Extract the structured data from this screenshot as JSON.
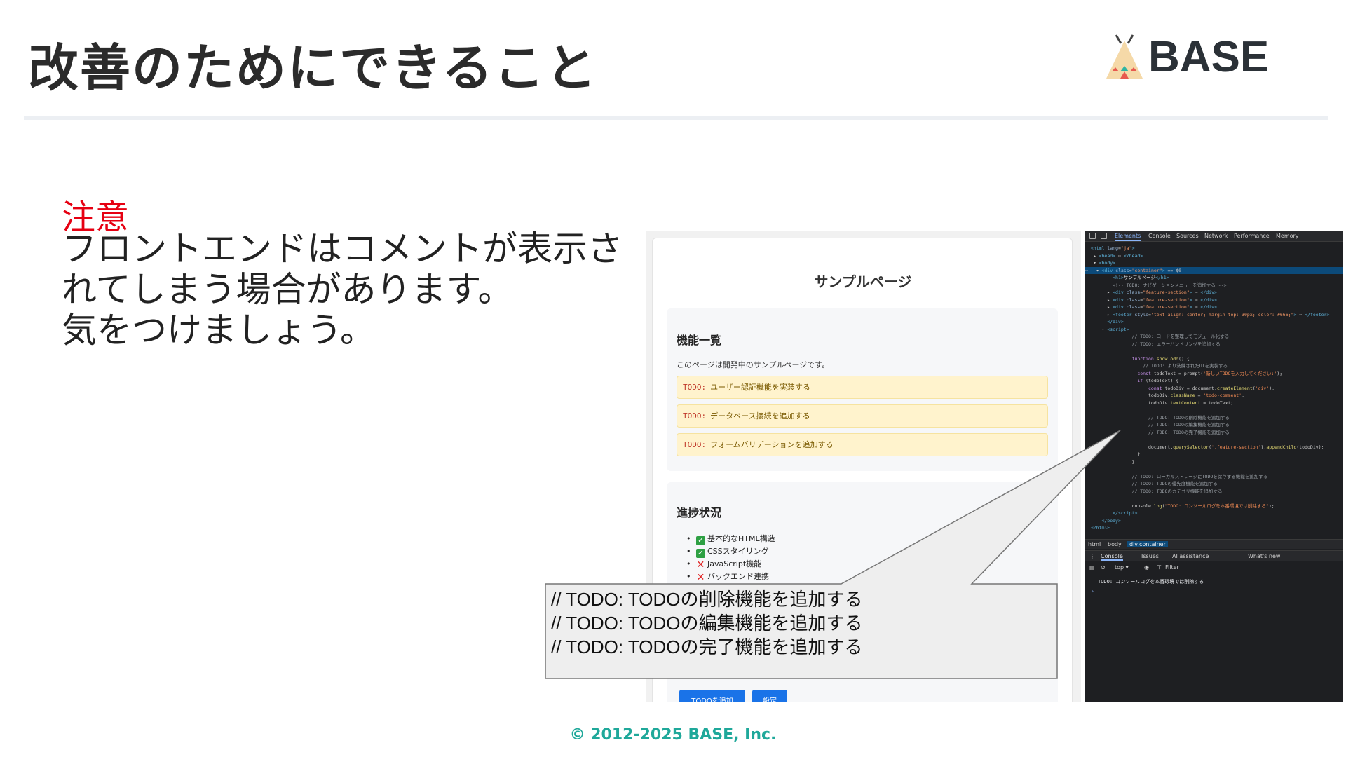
{
  "slide": {
    "title": "改善のためにできること",
    "logo_text": "BASE",
    "note_heading": "注意",
    "note_lines": [
      "フロントエンドはコメントが表示さ",
      "れてしまう場合があります。",
      "気をつけましょう。"
    ],
    "footer": "© 2012-2025 BASE, Inc."
  },
  "page": {
    "title": "サンプルページ",
    "features": {
      "heading": "機能一覧",
      "description": "このページは開発中のサンプルページです。",
      "todo_tag": "TODO:",
      "todos": [
        "ユーザー認証機能を実装する",
        "データベース接続を追加する",
        "フォームバリデーションを追加する"
      ]
    },
    "progress": {
      "heading": "進捗状況",
      "items": [
        {
          "label": "基本的なHTML構造",
          "done": true
        },
        {
          "label": "CSSスタイリング",
          "done": true
        },
        {
          "label": "JavaScript機能",
          "done": false
        },
        {
          "label": "バックエンド連携",
          "done": false
        }
      ]
    },
    "buttons": {
      "add": "TODOを追加",
      "settings": "設定"
    }
  },
  "callout": {
    "lines": [
      "// TODO: TODOの削除機能を追加する",
      "// TODO: TODOの編集機能を追加する",
      "// TODO: TODOの完了機能を追加する"
    ]
  },
  "devtools": {
    "tabs": [
      "Elements",
      "Console",
      "Sources",
      "Network",
      "Performance",
      "Memory"
    ],
    "active_tab": "Elements",
    "breadcrumb": [
      "html",
      "body",
      "div.container"
    ],
    "drawer_tabs": [
      "Console",
      "Issues",
      "AI assistance",
      "What's new"
    ],
    "console_context": "top ▾",
    "filter_placeholder": "Filter",
    "console_output": "TODO: コンソールログを本番環境では削除する",
    "prompt": "›"
  },
  "colors": {
    "accent_red": "#e60012",
    "footer_teal": "#1fa89a",
    "todo_bg": "#fff3cd",
    "button_blue": "#1a73e8",
    "devtools_bg": "#1e1f22"
  }
}
